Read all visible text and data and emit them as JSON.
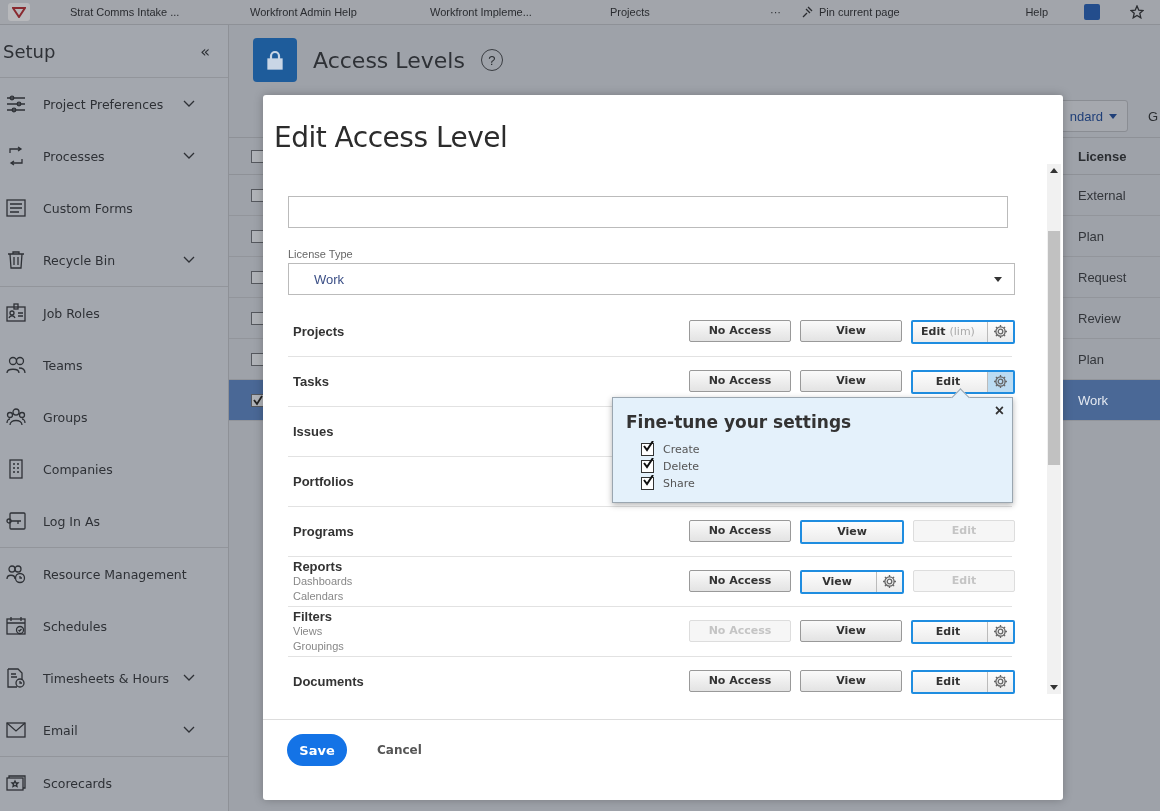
{
  "top_bar": {
    "tabs": [
      "Strat Comms Intake ...",
      "Workfront Admin Help",
      "Workfront Impleme...",
      "Projects"
    ],
    "more": "···",
    "pin": "Pin current page",
    "help": "Help"
  },
  "sidebar": {
    "title": "Setup",
    "collapse": "«",
    "sections": [
      [
        {
          "label": "Project Preferences",
          "kind": "group"
        },
        {
          "label": "Processes",
          "kind": "group"
        },
        {
          "label": "Custom Forms",
          "kind": "link"
        },
        {
          "label": "Recycle Bin",
          "kind": "group"
        }
      ],
      [
        {
          "label": "Job Roles",
          "kind": "link"
        },
        {
          "label": "Teams",
          "kind": "link"
        },
        {
          "label": "Groups",
          "kind": "link"
        },
        {
          "label": "Companies",
          "kind": "link"
        },
        {
          "label": "Log In As",
          "kind": "link"
        }
      ],
      [
        {
          "label": "Resource Management",
          "kind": "link"
        },
        {
          "label": "Schedules",
          "kind": "link"
        },
        {
          "label": "Timesheets & Hours",
          "kind": "group"
        },
        {
          "label": "Email",
          "kind": "group"
        }
      ],
      [
        {
          "label": "Scorecards",
          "kind": "link"
        }
      ]
    ]
  },
  "page": {
    "title": "Access Levels",
    "help": "?",
    "filter_button": "ndard",
    "cut_button": "G",
    "table": {
      "columns": [
        "License"
      ],
      "all_selected": false,
      "rows": [
        {
          "license": "External",
          "selected": false
        },
        {
          "license": "Plan",
          "selected": false
        },
        {
          "license": "Request",
          "selected": false
        },
        {
          "license": "Review",
          "selected": false
        },
        {
          "license": "Plan",
          "selected": false
        },
        {
          "license": "Work",
          "selected": true
        }
      ]
    }
  },
  "modal": {
    "title": "Edit Access Level",
    "license_label": "License Type",
    "license_value": "Work",
    "rows": [
      {
        "label": "Projects",
        "sublabels": [],
        "buttons": [
          {
            "label": "No Access",
            "kind": "plain",
            "selected": false,
            "disabled": false
          },
          {
            "label": "View",
            "kind": "plain",
            "selected": false,
            "disabled": false
          },
          {
            "label": "Edit",
            "note": "(lim)",
            "kind": "split",
            "selected": true,
            "disabled": false,
            "gear_pressed": false
          }
        ]
      },
      {
        "label": "Tasks",
        "sublabels": [],
        "buttons": [
          {
            "label": "No Access",
            "kind": "plain",
            "selected": false,
            "disabled": false
          },
          {
            "label": "View",
            "kind": "plain",
            "selected": false,
            "disabled": false
          },
          {
            "label": "Edit",
            "kind": "split",
            "selected": true,
            "disabled": false,
            "gear_pressed": true
          }
        ]
      },
      {
        "label": "Issues",
        "sublabels": [],
        "buttons": []
      },
      {
        "label": "Portfolios",
        "sublabels": [],
        "buttons": []
      },
      {
        "label": "Programs",
        "sublabels": [],
        "buttons": [
          {
            "label": "No Access",
            "kind": "plain",
            "selected": false,
            "disabled": false
          },
          {
            "label": "View",
            "kind": "plain",
            "selected": true,
            "disabled": false
          },
          {
            "label": "Edit",
            "kind": "plain",
            "selected": false,
            "disabled": true
          }
        ]
      },
      {
        "label": "Reports",
        "sublabels": [
          "Dashboards",
          "Calendars"
        ],
        "buttons": [
          {
            "label": "No Access",
            "kind": "plain",
            "selected": false,
            "disabled": false
          },
          {
            "label": "View",
            "kind": "split",
            "selected": true,
            "disabled": false,
            "gear_pressed": false
          },
          {
            "label": "Edit",
            "kind": "plain",
            "selected": false,
            "disabled": true
          }
        ]
      },
      {
        "label": "Filters",
        "sublabels": [
          "Views",
          "Groupings"
        ],
        "buttons": [
          {
            "label": "No Access",
            "kind": "plain",
            "selected": false,
            "disabled": true
          },
          {
            "label": "View",
            "kind": "plain",
            "selected": false,
            "disabled": false
          },
          {
            "label": "Edit",
            "kind": "split",
            "selected": true,
            "disabled": false,
            "gear_pressed": false
          }
        ]
      },
      {
        "label": "Documents",
        "sublabels": [],
        "buttons": [
          {
            "label": "No Access",
            "kind": "plain",
            "selected": false,
            "disabled": false
          },
          {
            "label": "View",
            "kind": "plain",
            "selected": false,
            "disabled": false
          },
          {
            "label": "Edit",
            "kind": "split",
            "selected": true,
            "disabled": false,
            "gear_pressed": false
          }
        ]
      }
    ],
    "popover": {
      "title": "Fine-tune your settings",
      "close": "×",
      "options": [
        {
          "label": "Create",
          "checked": true
        },
        {
          "label": "Delete",
          "checked": true
        },
        {
          "label": "Share",
          "checked": true
        }
      ]
    },
    "save": "Save",
    "cancel": "Cancel"
  }
}
